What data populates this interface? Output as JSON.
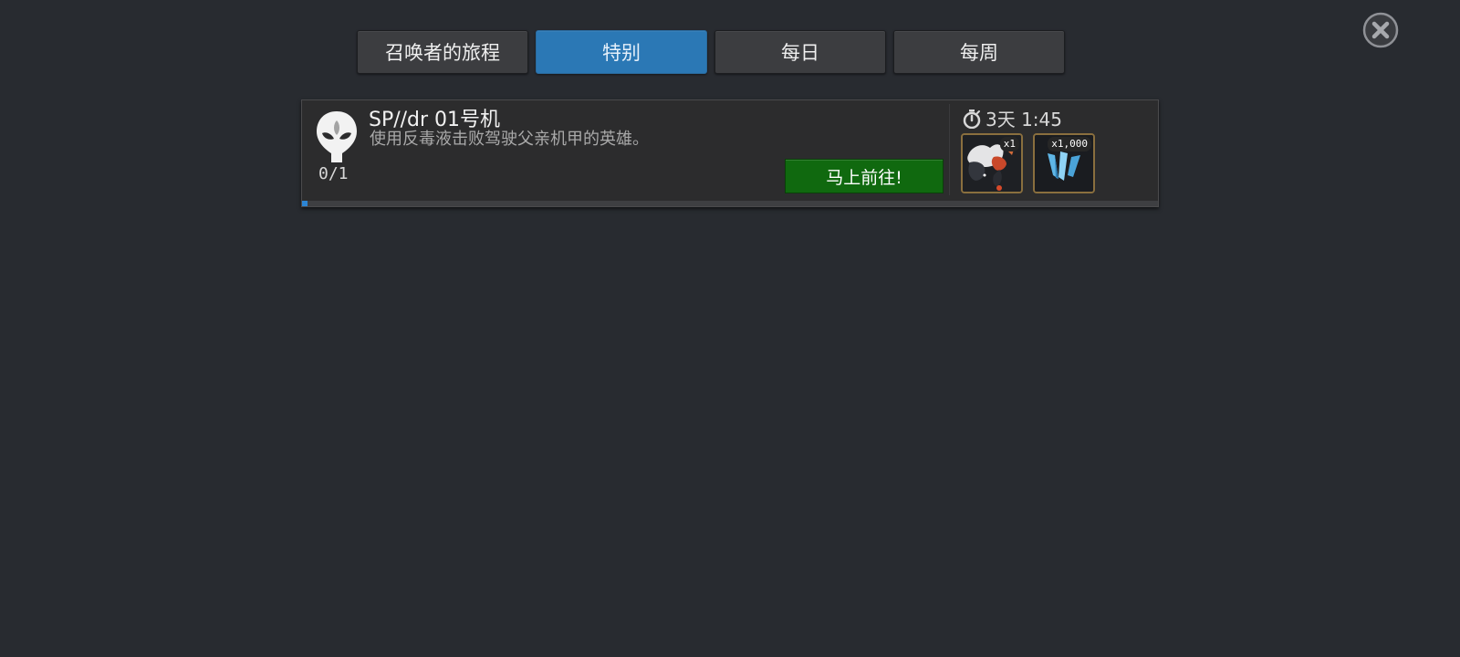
{
  "tabs": [
    {
      "label": "召唤者的旅程",
      "active": false
    },
    {
      "label": "特别",
      "active": true
    },
    {
      "label": "每日",
      "active": false
    },
    {
      "label": "每周",
      "active": false
    }
  ],
  "close_icon": "close-circle-icon",
  "quest": {
    "icon": "alien-head-icon",
    "title": "SP//dr 01号机",
    "description": "使用反毒液击败驾驶父亲机甲的英雄。",
    "progress_text": "0/1",
    "progress": {
      "current": 0,
      "total": 1
    },
    "go_button_label": "马上前往!",
    "timer_icon": "stopwatch-icon",
    "timer_text": "3天 1:45",
    "rewards": [
      {
        "icon": "character-reward-icon",
        "quantity": "x1"
      },
      {
        "icon": "crystal-shards-icon",
        "quantity": "x1,000"
      }
    ]
  },
  "colors": {
    "background": "#282b30",
    "active_tab": "#2b78b5",
    "go_button": "#10690f",
    "progress_fill": "#2c85d4",
    "reward_frame": "#8a6f3e"
  }
}
